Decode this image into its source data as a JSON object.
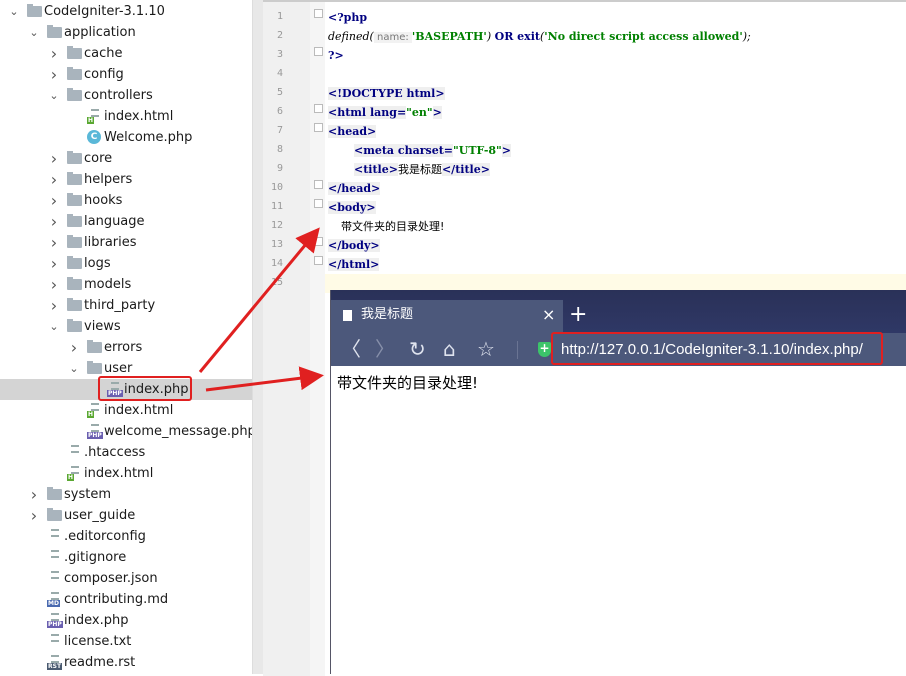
{
  "tree": [
    {
      "label": "CodeIgniter-3.1.10",
      "level": 0,
      "kind": "folder",
      "expanded": true
    },
    {
      "label": "application",
      "level": 1,
      "kind": "folder",
      "expanded": true
    },
    {
      "label": "cache",
      "level": 2,
      "kind": "folder",
      "expanded": false
    },
    {
      "label": "config",
      "level": 2,
      "kind": "folder",
      "expanded": false
    },
    {
      "label": "controllers",
      "level": 2,
      "kind": "folder",
      "expanded": true
    },
    {
      "label": "index.html",
      "level": 3,
      "kind": "file",
      "icon": "html-file-icon"
    },
    {
      "label": "Welcome.php",
      "level": 3,
      "kind": "file",
      "icon": "php-class-icon"
    },
    {
      "label": "core",
      "level": 2,
      "kind": "folder",
      "expanded": false
    },
    {
      "label": "helpers",
      "level": 2,
      "kind": "folder",
      "expanded": false
    },
    {
      "label": "hooks",
      "level": 2,
      "kind": "folder",
      "expanded": false
    },
    {
      "label": "language",
      "level": 2,
      "kind": "folder",
      "expanded": false
    },
    {
      "label": "libraries",
      "level": 2,
      "kind": "folder",
      "expanded": false
    },
    {
      "label": "logs",
      "level": 2,
      "kind": "folder",
      "expanded": false
    },
    {
      "label": "models",
      "level": 2,
      "kind": "folder",
      "expanded": false
    },
    {
      "label": "third_party",
      "level": 2,
      "kind": "folder",
      "expanded": false
    },
    {
      "label": "views",
      "level": 2,
      "kind": "folder",
      "expanded": true
    },
    {
      "label": "errors",
      "level": 3,
      "kind": "folder",
      "expanded": false
    },
    {
      "label": "user",
      "level": 3,
      "kind": "folder",
      "expanded": true
    },
    {
      "label": "index.php",
      "level": 4,
      "kind": "file",
      "icon": "php-file-icon",
      "selected": true
    },
    {
      "label": "index.html",
      "level": 3,
      "kind": "file",
      "icon": "html-file-icon"
    },
    {
      "label": "welcome_message.php",
      "level": 3,
      "kind": "file",
      "icon": "php-file-icon"
    },
    {
      "label": ".htaccess",
      "level": 2,
      "kind": "file",
      "icon": "htaccess-file-icon"
    },
    {
      "label": "index.html",
      "level": 2,
      "kind": "file",
      "icon": "html-file-icon"
    },
    {
      "label": "system",
      "level": 1,
      "kind": "folder",
      "expanded": false
    },
    {
      "label": "user_guide",
      "level": 1,
      "kind": "folder",
      "expanded": false
    },
    {
      "label": ".editorconfig",
      "level": 1,
      "kind": "file",
      "icon": "text-file-icon"
    },
    {
      "label": ".gitignore",
      "level": 1,
      "kind": "file",
      "icon": "text-file-icon"
    },
    {
      "label": "composer.json",
      "level": 1,
      "kind": "file",
      "icon": "json-file-icon"
    },
    {
      "label": "contributing.md",
      "level": 1,
      "kind": "file",
      "icon": "md-file-icon"
    },
    {
      "label": "index.php",
      "level": 1,
      "kind": "file",
      "icon": "php-file-icon"
    },
    {
      "label": "license.txt",
      "level": 1,
      "kind": "file",
      "icon": "text-file-icon"
    },
    {
      "label": "readme.rst",
      "level": 1,
      "kind": "file",
      "icon": "rst-file-icon"
    }
  ],
  "code": [
    {
      "n": "1",
      "fold": true,
      "tokens": [
        {
          "t": "<?php",
          "c": "kw"
        }
      ]
    },
    {
      "n": "2",
      "tokens": [
        {
          "t": "defined(",
          "c": "fn"
        },
        {
          "t": " name: ",
          "c": "hint"
        },
        {
          "t": "'BASEPATH'",
          "c": "str"
        },
        {
          "t": ") ",
          "c": "fn"
        },
        {
          "t": "OR exit",
          "c": "kw"
        },
        {
          "t": "(",
          "c": "fn"
        },
        {
          "t": "'No direct script access allowed'",
          "c": "str"
        },
        {
          "t": ");",
          "c": "fn"
        }
      ]
    },
    {
      "n": "3",
      "fold": true,
      "tokens": [
        {
          "t": "?>",
          "c": "kw"
        }
      ]
    },
    {
      "n": "4",
      "tokens": []
    },
    {
      "n": "5",
      "tokens": [
        {
          "t": "<!DOCTYPE ",
          "c": "tag"
        },
        {
          "t": "html>",
          "c": "tag"
        }
      ]
    },
    {
      "n": "6",
      "fold": true,
      "tokens": [
        {
          "t": "<html lang=",
          "c": "tag"
        },
        {
          "t": "\"en\"",
          "c": "str"
        },
        {
          "t": ">",
          "c": "tag"
        }
      ]
    },
    {
      "n": "7",
      "fold": true,
      "tokens": [
        {
          "t": "<head>",
          "c": "tag"
        }
      ]
    },
    {
      "n": "8",
      "indent": 2,
      "tokens": [
        {
          "t": "<meta charset=",
          "c": "tag"
        },
        {
          "t": "\"UTF-8\"",
          "c": "str"
        },
        {
          "t": ">",
          "c": "tag"
        }
      ]
    },
    {
      "n": "9",
      "indent": 2,
      "tokens": [
        {
          "t": "<title>",
          "c": "tag"
        },
        {
          "t": "我是标题",
          "c": "txt"
        },
        {
          "t": "</title>",
          "c": "tag"
        }
      ]
    },
    {
      "n": "10",
      "fold": true,
      "tokens": [
        {
          "t": "</head>",
          "c": "tag"
        }
      ]
    },
    {
      "n": "11",
      "fold": true,
      "tokens": [
        {
          "t": "<body>",
          "c": "tag"
        }
      ]
    },
    {
      "n": "12",
      "indent": 1,
      "tokens": [
        {
          "t": "带文件夹的目录处理!",
          "c": "txt"
        }
      ]
    },
    {
      "n": "13",
      "fold": true,
      "tokens": [
        {
          "t": "</body>",
          "c": "tag"
        }
      ]
    },
    {
      "n": "14",
      "fold": true,
      "tokens": [
        {
          "t": "</html>",
          "c": "tag"
        }
      ]
    },
    {
      "n": "15",
      "tokens": []
    }
  ],
  "browser": {
    "tab_title": "我是标题",
    "tab_close": "×",
    "new_tab": "+",
    "url": "http://127.0.0.1/CodeIgniter-3.1.10/index.php/",
    "content": "带文件夹的目录处理!",
    "nav": {
      "back": "〈",
      "forward": "〉",
      "reload": "↻",
      "home": "⌂",
      "favorite": "☆"
    }
  },
  "colors": {
    "highlight": "#e02020",
    "browser_chrome": "#4c587b",
    "selection": "#d4d4d4"
  }
}
